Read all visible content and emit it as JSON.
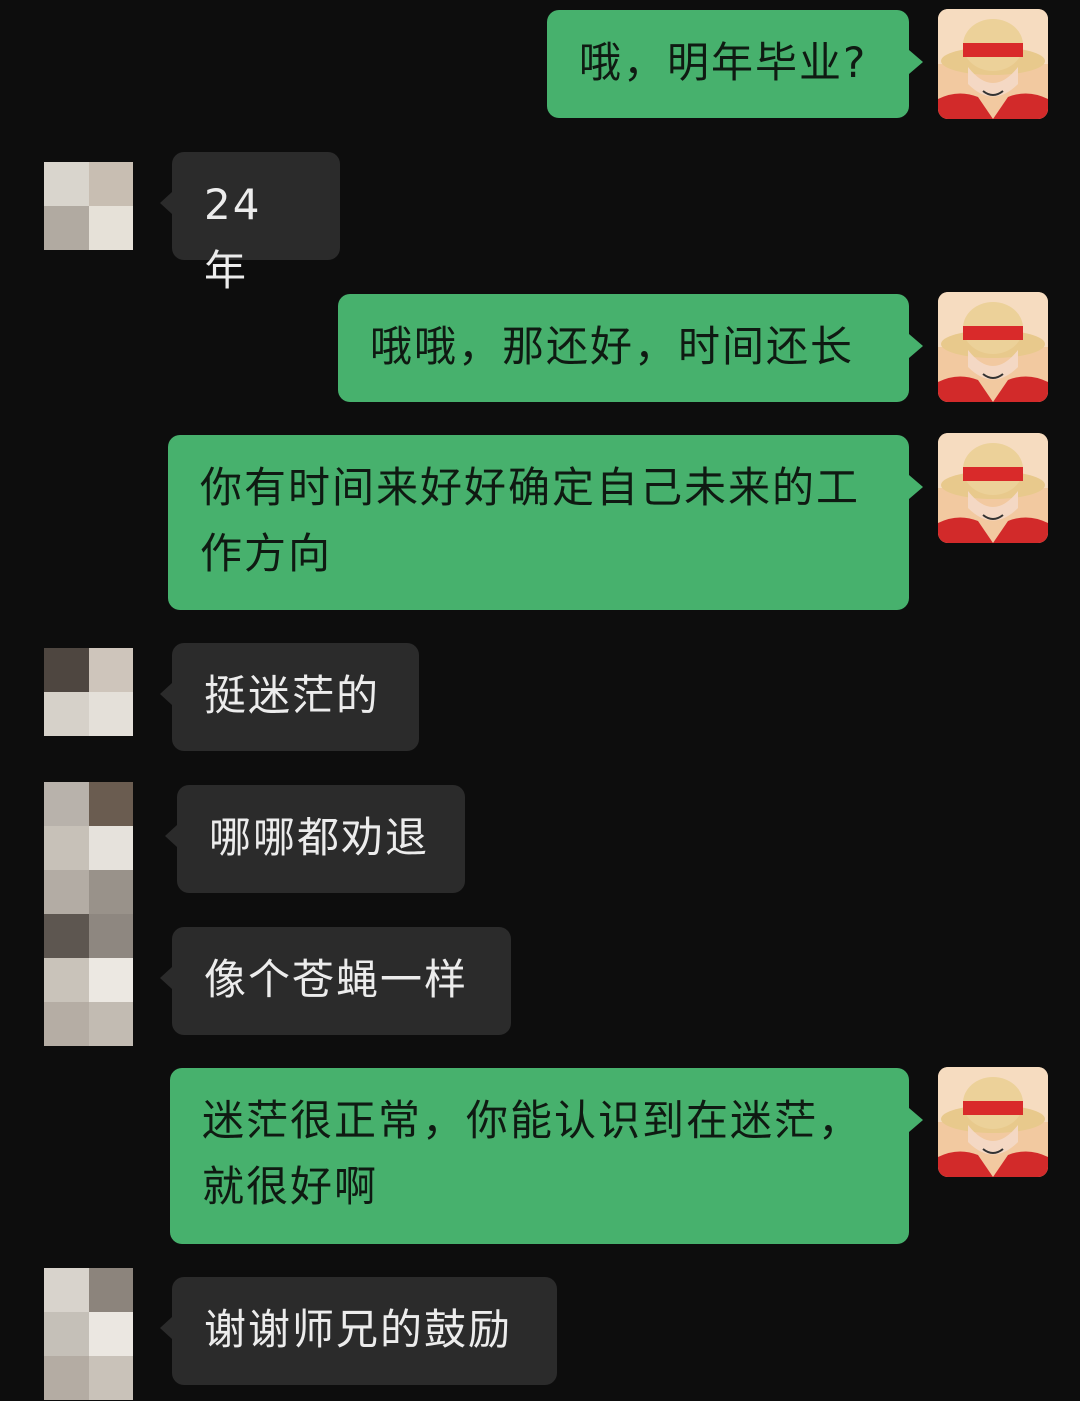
{
  "messages": [
    {
      "side": "me",
      "text": "哦，明年毕业?"
    },
    {
      "side": "them",
      "text": "24 年"
    },
    {
      "side": "me",
      "text": "哦哦，那还好，时间还长"
    },
    {
      "side": "me",
      "lines": [
        "你有时间来好好确定自己未来的工",
        "作方向"
      ]
    },
    {
      "side": "them",
      "text": "挺迷茫的"
    },
    {
      "side": "them",
      "text": "哪哪都劝退"
    },
    {
      "side": "them",
      "text": "像个苍蝇一样"
    },
    {
      "side": "me",
      "lines": [
        "迷茫很正常，你能认识到在迷茫，",
        "就很好啊"
      ]
    },
    {
      "side": "them",
      "text": "谢谢师兄的鼓励"
    }
  ],
  "colors": {
    "background": "#0d0d0d",
    "my_bubble": "#47b16d",
    "their_bubble": "#2b2b2b"
  },
  "icons": {
    "my_avatar": "straw-hat-avatar-icon",
    "their_avatar": "pixelated-avatar-icon"
  }
}
